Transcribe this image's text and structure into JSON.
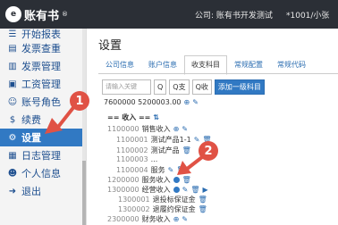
{
  "header": {
    "logo_mark": "e",
    "app_name": "账有书",
    "app_sup": "®",
    "company_label": "公司: 账有书开发测试",
    "user_label": "*1001/小张"
  },
  "sidebar": {
    "items": [
      {
        "label": "开始报表",
        "icon": "list-icon"
      },
      {
        "label": "发票查重",
        "icon": "invoice-icon"
      },
      {
        "label": "发票管理",
        "icon": "barcode-icon"
      },
      {
        "label": "工资管理",
        "icon": "wallet-icon"
      },
      {
        "label": "账号角色",
        "icon": "user-icon"
      },
      {
        "label": "续费",
        "icon": "dollar-icon"
      },
      {
        "label": "设置",
        "icon": "gear-icon"
      },
      {
        "label": "日志管理",
        "icon": "calendar-icon"
      },
      {
        "label": "个人信息",
        "icon": "person-icon"
      },
      {
        "label": "退出",
        "icon": "exit-icon"
      }
    ],
    "active_label": "设置"
  },
  "main": {
    "title": "设置",
    "tabs": [
      "公司信息",
      "账户信息",
      "收支科目",
      "常规配置",
      "常规代码"
    ],
    "active_tab": "收支科目",
    "search_placeholder": "请输入关键",
    "btn_search": "Q",
    "btn_expense": "Q支",
    "btn_income": "Q收",
    "btn_add": "添加一级科目",
    "rows": [
      {
        "code": "7600000 5200003.00",
        "name": ""
      },
      {
        "code": "== 收入 ==",
        "name": ""
      },
      {
        "code": "1100000",
        "name": "销售收入"
      },
      {
        "code": "1100001",
        "name": "测试产品1-1"
      },
      {
        "code": "1100002",
        "name": "测试产品"
      },
      {
        "code": "1100003",
        "name": "..."
      },
      {
        "code": "1100004",
        "name": "服务"
      },
      {
        "code": "1200000",
        "name": "服务收入"
      },
      {
        "code": "1300000",
        "name": "经营收入"
      },
      {
        "code": "1300001",
        "name": "退投标保证金"
      },
      {
        "code": "1300002",
        "name": "退履约保证金"
      },
      {
        "code": "2300000",
        "name": "财务收入"
      }
    ]
  },
  "annotations": {
    "marker1": "1",
    "marker2": "2"
  }
}
